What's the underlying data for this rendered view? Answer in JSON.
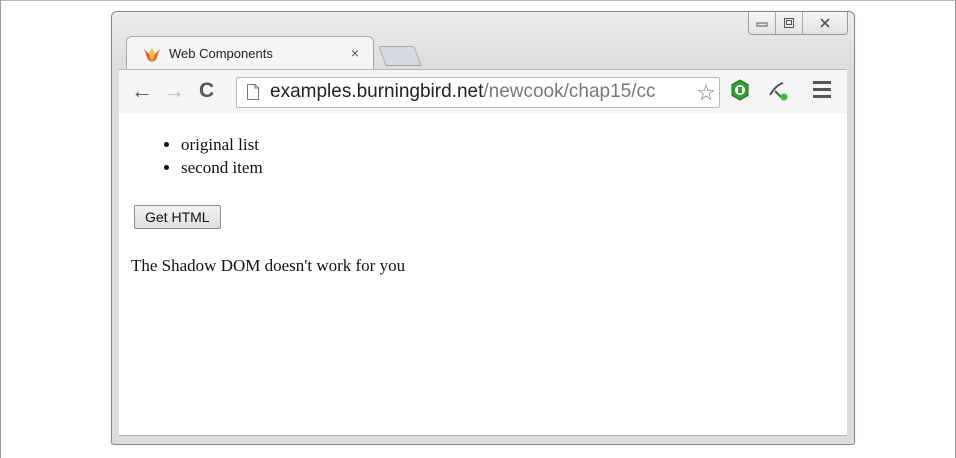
{
  "window": {
    "controls": [
      "minimize-icon",
      "maximize-icon",
      "close-icon"
    ]
  },
  "tab": {
    "title": "Web Components",
    "close": "×",
    "favicon": "firefox-icon"
  },
  "toolbar": {
    "back": "←",
    "forward": "→",
    "reload": "C",
    "url_host": "examples.burningbird.net",
    "url_path": "/newcook/chap15/cc",
    "star": "☆"
  },
  "page": {
    "list": [
      "original list",
      "second item"
    ],
    "button_label": "Get HTML",
    "message": "The Shadow DOM doesn't work for you"
  },
  "colors": {
    "extension_green": "#2f9f2f",
    "status_green": "#34c234"
  }
}
